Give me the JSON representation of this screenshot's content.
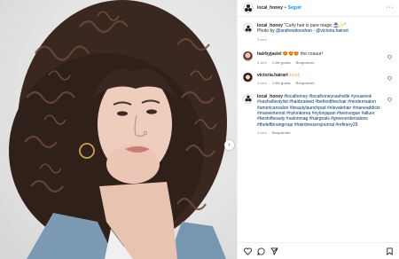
{
  "header": {
    "username": "local_honey",
    "separator": "•",
    "follow_label": "Seguir",
    "more_label": "···"
  },
  "caption": {
    "username": "local_honey",
    "text": "\"Curly hair is pure magic 🧙🏻‍♀️✨\"",
    "photo_prefix": "Photo by ",
    "photo_credit": "@andrewdooshan",
    "photo_sep": " - ",
    "photo_credit2": "@victoria.hairart",
    "time": "3 sem"
  },
  "comments": [
    {
      "username": "hairbyjasiel",
      "text": "😍😍😍 the couuur!",
      "time": "3 sem",
      "likes": "1 Me gusta",
      "reply": "Responder"
    },
    {
      "username": "victoria.hairart",
      "text": "🙌🏻🙌🏻",
      "time": "3 sem",
      "likes": "1 Me gusta",
      "reply": "Responder"
    },
    {
      "username": "local_honey",
      "text": "#localhoney #localhoneynashville #youareok #nashvillestylist #hairbrained #behindthechair #modernsalon #americansalon #beautylaunchpad #elevatehair #maneaddicts #maneinterest #nylonkorea #nylonjapan #teenvogue #allure #bestofbeauty #salonmag #hairgoals #greenordersalons #theleftbraingroup #hairdressersjournal #refinery29",
      "time": "3 sem",
      "reply": "Responder"
    }
  ],
  "icons": [
    "heart-icon",
    "comment-icon",
    "share-icon",
    "bookmark-icon",
    "chevron-right-icon"
  ],
  "photo": {
    "arrow": "›"
  },
  "colors": {
    "accent": "#0095f6",
    "hashtag": "#00376b",
    "muted": "#8e8e8e"
  }
}
